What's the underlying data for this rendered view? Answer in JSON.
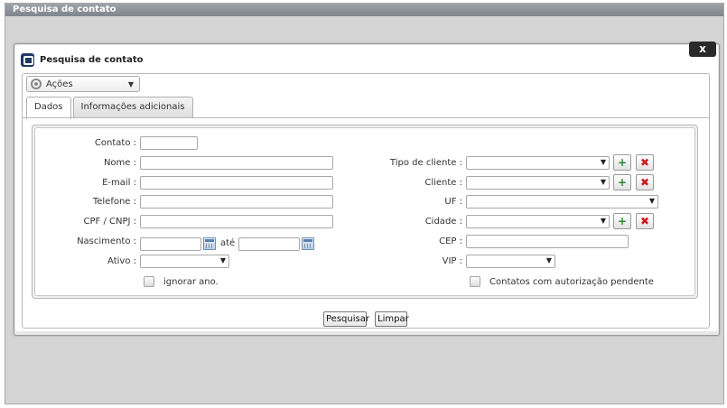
{
  "window": {
    "title": "Pesquisa de contato"
  },
  "dialog": {
    "title": "Pesquisa de contato",
    "close_label": "x"
  },
  "actions_menu": {
    "label": "Ações"
  },
  "tabs": [
    {
      "label": "Dados",
      "active": true
    },
    {
      "label": "Informações adicionais",
      "active": false
    }
  ],
  "form": {
    "contato": {
      "label": "Contato :",
      "value": ""
    },
    "nome": {
      "label": "Nome :",
      "value": ""
    },
    "email": {
      "label": "E-mail :",
      "value": ""
    },
    "telefone": {
      "label": "Telefone :",
      "value": ""
    },
    "cpf_cnpj": {
      "label": "CPF / CNPJ :",
      "value": ""
    },
    "nascimento": {
      "label": "Nascimento :",
      "from": "",
      "to": "",
      "separator": "até"
    },
    "ativo": {
      "label": "Ativo :",
      "value": ""
    },
    "ignorar_ano": {
      "label": "ignorar ano.",
      "checked": false
    },
    "tipo_cliente": {
      "label": "Tipo de cliente :",
      "value": ""
    },
    "cliente": {
      "label": "Cliente :",
      "value": ""
    },
    "uf": {
      "label": "UF :",
      "value": ""
    },
    "cidade": {
      "label": "Cidade :",
      "value": ""
    },
    "cep": {
      "label": "CEP :",
      "value": ""
    },
    "vip": {
      "label": "VIP :",
      "value": ""
    },
    "autorizacao_pendente": {
      "label": "Contatos com autorização pendente",
      "checked": false
    }
  },
  "buttons": {
    "search": "Pesquisar",
    "clear": "Limpar"
  },
  "icons": {
    "dropdown_arrow": "▼",
    "add": "+",
    "remove": "✖"
  },
  "colors": {
    "title_bar": "#858b91",
    "add_icon": "#2c8a2c",
    "remove_icon": "#d11b1b",
    "close_bg": "#2a2a2a"
  }
}
